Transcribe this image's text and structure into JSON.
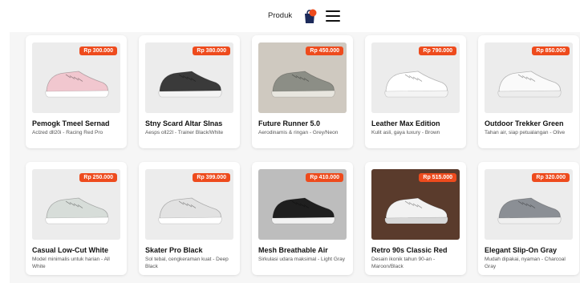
{
  "header": {
    "nav_label": "Produk",
    "cart_icon": "shopping-bag-icon",
    "menu_icon": "hamburger-menu-icon",
    "accent": "#ee4b1d"
  },
  "products": [
    {
      "name": "Pemogk Tmeel Sernad",
      "desc": "Aclzed dll20i - Racing Red Pro",
      "price": "Rp 300.000",
      "bg": "#ececec",
      "shoe": "#f1c7cf",
      "sole": "#ffffff"
    },
    {
      "name": "Stny Scard Altar SInas",
      "desc": "Aesps oll22l - Trainer Black/White",
      "price": "Rp 380.000",
      "bg": "#ececec",
      "shoe": "#3a3a3a",
      "sole": "#f4f4f4"
    },
    {
      "name": "Future Runner 5.0",
      "desc": "Aerodinamis & ringan - Grey/Neon",
      "price": "Rp 450.000",
      "bg": "#cfc9c0",
      "shoe": "#8c8e86",
      "sole": "#e8e6df"
    },
    {
      "name": "Leather Max Edition",
      "desc": "Kulit asli, gaya luxury - Brown",
      "price": "Rp 790.000",
      "bg": "#ececec",
      "shoe": "#ffffff",
      "sole": "#f4f4f4"
    },
    {
      "name": "Outdoor Trekker Green",
      "desc": "Tahan air, siap petualangan - Olive",
      "price": "Rp 850.000",
      "bg": "#ececec",
      "shoe": "#fafafa",
      "sole": "#ededed"
    },
    {
      "name": "Casual Low-Cut White",
      "desc": "Model minimalis untuk harian - All White",
      "price": "Rp 250.000",
      "bg": "#ececec",
      "shoe": "#d7ddd9",
      "sole": "#ffffff"
    },
    {
      "name": "Skater Pro Black",
      "desc": "Sol tebal, cengkeraman kuat - Deep Black",
      "price": "Rp 399.000",
      "bg": "#ececec",
      "shoe": "#e2e2e2",
      "sole": "#ffffff"
    },
    {
      "name": "Mesh Breathable Air",
      "desc": "Sirkulasi udara maksimal - Light Gray",
      "price": "Rp 410.000",
      "bg": "#bdbdbd",
      "shoe": "#1f1f1f",
      "sole": "#f2f2f2"
    },
    {
      "name": "Retro 90s Classic Red",
      "desc": "Desain ikonik tahun 90-an - Maroon/Black",
      "price": "Rp 515.000",
      "bg": "#5a3b2c",
      "shoe": "#f2f2f2",
      "sole": "#d8d8d8"
    },
    {
      "name": "Elegant Slip-On Gray",
      "desc": "Mudah dipakai, nyaman - Charcoal Gray",
      "price": "Rp 320.000",
      "bg": "#ececec",
      "shoe": "#8b8f95",
      "sole": "#f0f0f0"
    }
  ]
}
